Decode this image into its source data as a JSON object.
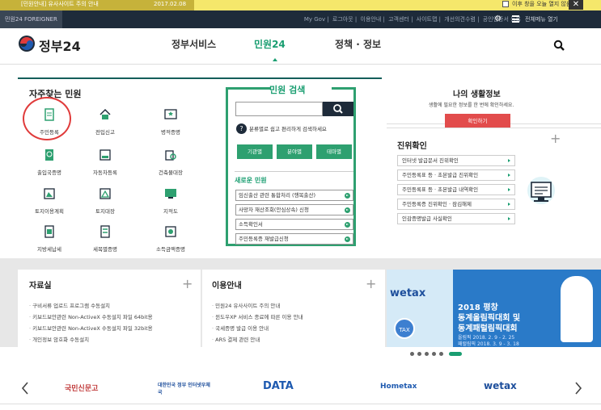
{
  "notice": {
    "text": "[민원안내] 유사사이트 주의 안내",
    "date": "2017.02.08",
    "checkbox_label": "이후 창을 오늘 열지 않음",
    "close": "✕"
  },
  "util": {
    "lang": "민원24 FOREIGNER",
    "links": [
      "My Gov",
      "로그아웃",
      "이용안내",
      "고객센터",
      "사이트맵",
      "개선의견수렴",
      "공인인증서 등록"
    ],
    "all_menu": "전체메뉴 열기"
  },
  "header": {
    "logo_text": "정부24",
    "nav": [
      "정부서비스",
      "민원24",
      "정책 · 정보"
    ]
  },
  "favorites": {
    "title": "자주찾는 민원",
    "items": [
      "주민등록",
      "전입신고",
      "병적증명",
      "출입국증명",
      "자동차등록",
      "건축물대장",
      "토지이용계획",
      "토지대장",
      "지적도",
      "지방세납세",
      "세목별증명",
      "소득금액증명"
    ]
  },
  "minwon_search": {
    "title": "민원 검색",
    "desc": "분류별로 쉽고 편리하게 검색하세요",
    "buttons": [
      "기관별",
      "분야별",
      "테마별"
    ],
    "new_title": "새로운 민원",
    "new_items": [
      "임신출산 관련 통합처리 (행복출산)",
      "사망자 재산조회(안심상속) 신청",
      "소득확인서",
      "주민등록증 재발급신청"
    ]
  },
  "life": {
    "title": "나의 생활정보",
    "sub": "생활에 필요한 정보를 한 번에 확인하세요.",
    "button": "확인하기"
  },
  "id_check": {
    "title": "진위확인",
    "items": [
      "인터넷 발급문서 진위확인",
      "주민등록표 등 · 초본발급 진위확인",
      "주민등록표 등 · 초본발급 내역확인",
      "주민등록증 진위확인 · 잠김해제",
      "인감증명발급 사실확인"
    ]
  },
  "data_room": {
    "title": "자료실",
    "items": [
      "구비서류 업로드 프로그램 수동설치",
      "키보드보안관련 Non-ActiveX 수동설치 파일 64bit용",
      "키보드보안관련 Non-ActiveX 수동설치 파일 32bit용",
      "개인정보 암호화 수동설치"
    ]
  },
  "guide": {
    "title": "이용안내",
    "items": [
      "민원24 유사사이트 주의 안내",
      "윈도우XP 서비스 종료에 따른 이용 안내",
      "국세증명 발급 이용 안내",
      "ARS 결제 관련 안내"
    ]
  },
  "banner": {
    "wetax": "wetax",
    "title1": "2018 평창",
    "title2": "동계올림픽대회 및",
    "title3": "동계패럴림픽대회",
    "dates1": "올림픽 2018. 2. 9 - 2. 25",
    "dates2": "패럴림픽 2018. 3. 9 - 3. 18",
    "tax": "TAX",
    "mascot": "수호랑"
  },
  "partners": [
    "국민신문고",
    "대한민국 정부 인터넷우체국",
    "DATA",
    "Hometax",
    "wetax"
  ],
  "colors": {
    "accent": "#1a9e71",
    "dark": "#1e2b3a",
    "red": "#e24c4c"
  }
}
